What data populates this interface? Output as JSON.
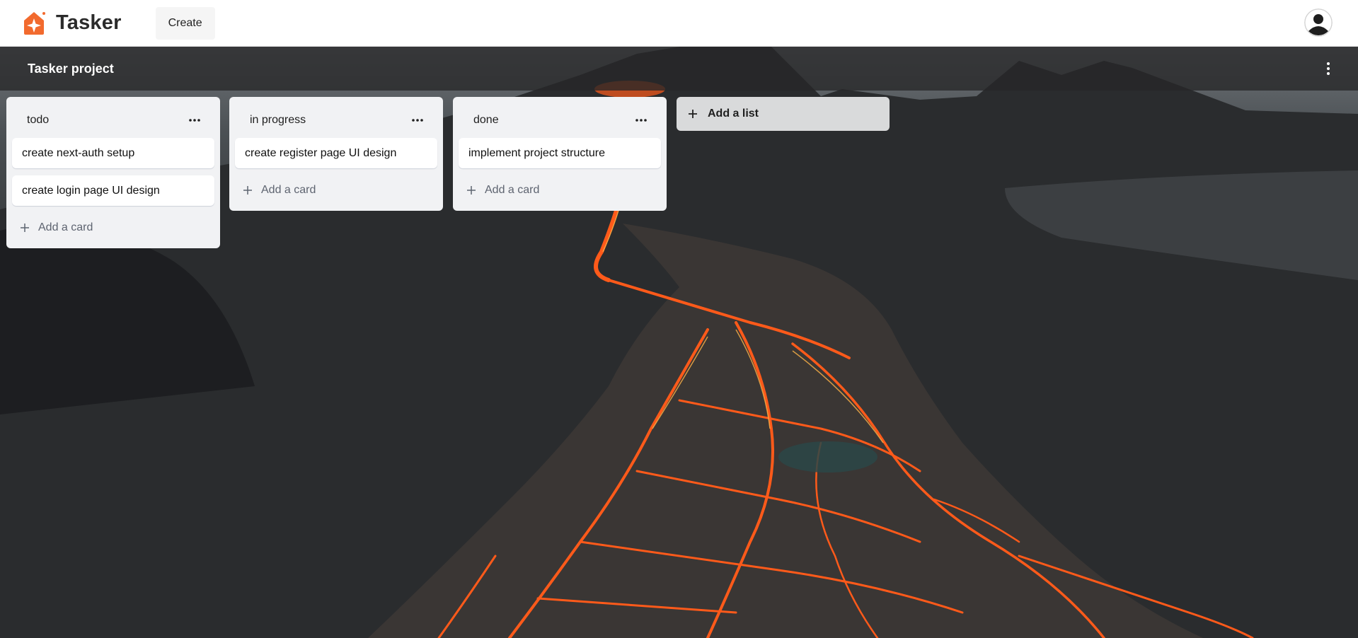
{
  "navbar": {
    "brand": "Tasker",
    "create_label": "Create",
    "avatar_icon": "user-avatar-icon"
  },
  "board": {
    "title": "Tasker project",
    "menu_icon": "vertical-dots-icon"
  },
  "lists": [
    {
      "title": "todo",
      "cards": [
        "create next-auth setup",
        "create login page UI design"
      ],
      "add_card_label": "Add a card"
    },
    {
      "title": "in progress",
      "cards": [
        "create register page UI design"
      ],
      "add_card_label": "Add a card"
    },
    {
      "title": "done",
      "cards": [
        "implement project structure"
      ],
      "add_card_label": "Add a card"
    }
  ],
  "add_list_label": "Add a list",
  "colors": {
    "brand_orange": "#f26a2e",
    "navbar_bg": "#ffffff",
    "list_bg": "#f1f2f4",
    "board_header_bg": "#262628"
  }
}
